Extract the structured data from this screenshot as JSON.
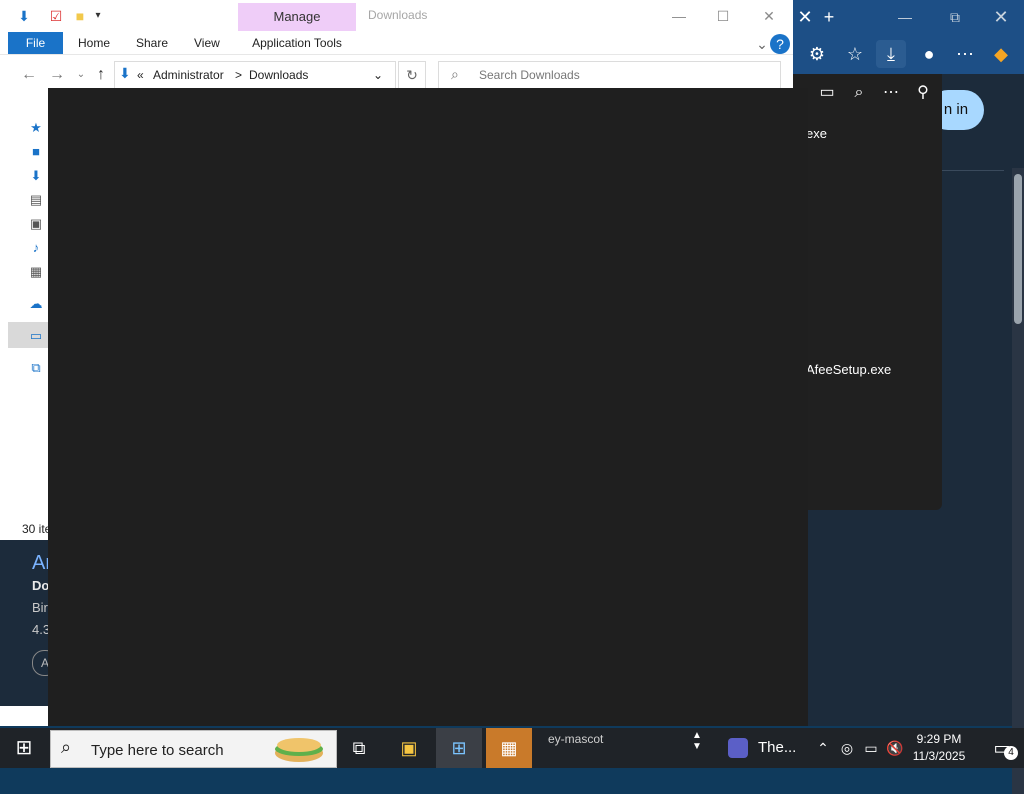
{
  "explorer": {
    "window_title": "Downloads",
    "manage_tab": "Manage",
    "ribbon": {
      "file": "File",
      "home": "Home",
      "share": "Share",
      "view": "View",
      "app_tools": "Application Tools"
    },
    "address": {
      "chevrons": "«",
      "root": "Administrator",
      "sep": ">",
      "folder": "Downloads"
    },
    "search_placeholder": "Search Downloads",
    "status": "30 ite"
  },
  "edge": {
    "signin": "n in",
    "flyout": {
      "item1": "exe",
      "item2": "AfeeSetup.exe"
    }
  },
  "leftpage": {
    "t1": "Ar",
    "t2": "Do",
    "t3": "Bir",
    "t4": "4.3",
    "circle": "A"
  },
  "taskbar": {
    "search_placeholder": "Type here to search",
    "overflow_label": "ey-mascot",
    "teams_label": "The...",
    "time": "9:29 PM",
    "date": "11/3/2025",
    "notification_count": "4"
  },
  "icons": {
    "windows": "windows-icon",
    "search": "search-icon",
    "task_view": "task-view-icon",
    "notifications": "notification-icon"
  }
}
